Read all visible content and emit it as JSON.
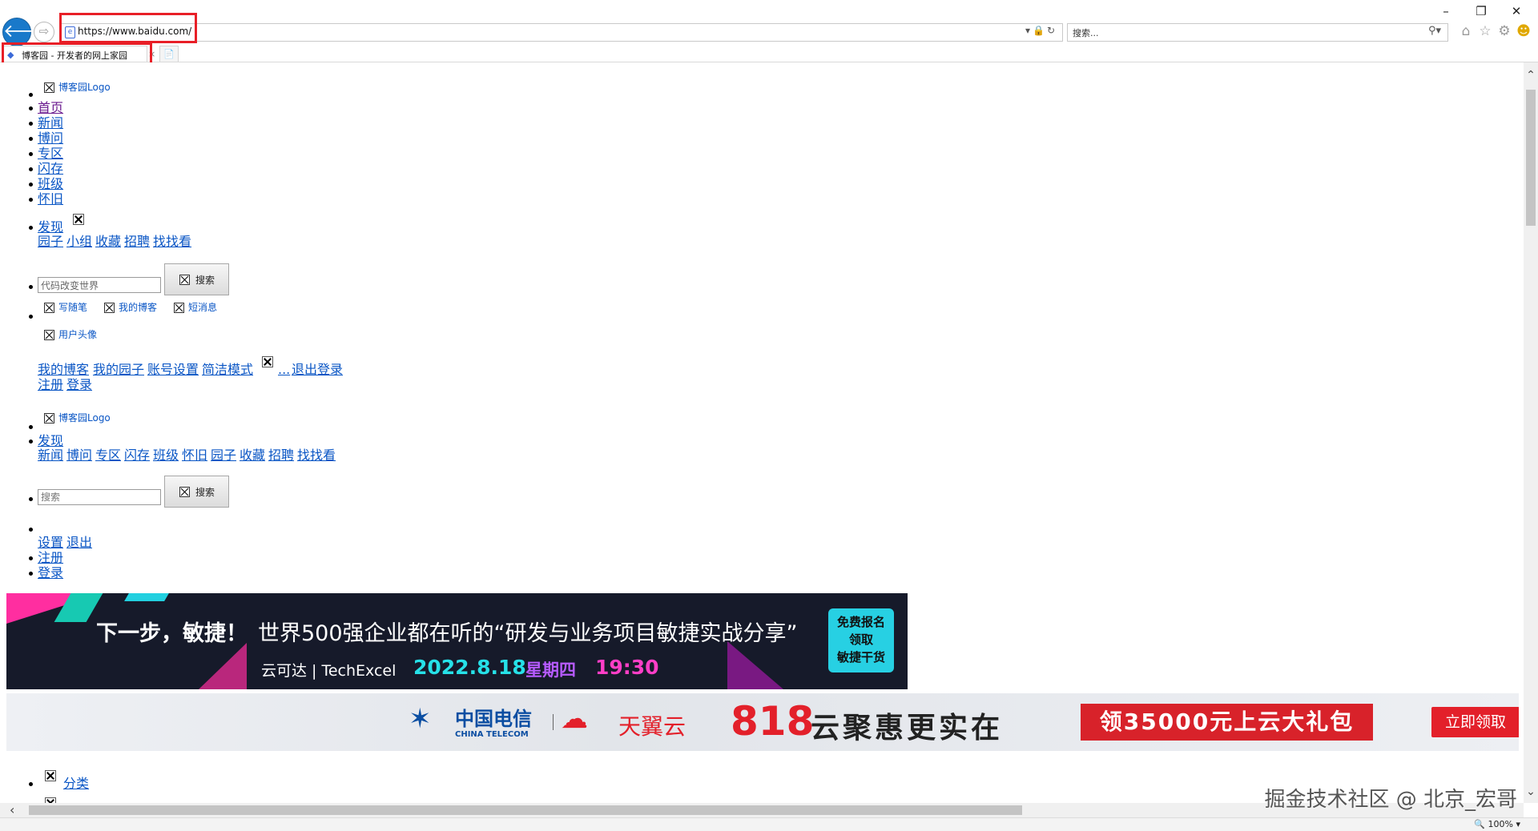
{
  "browser": {
    "url": "https://www.baidu.com/",
    "search_placeholder": "搜索...",
    "tab_title": "博客园 - 开发者的网上家园",
    "zoom": "100%"
  },
  "nav": {
    "logo_alt": "博客园Logo",
    "items": [
      "首页",
      "新闻",
      "博问",
      "专区",
      "闪存",
      "班级",
      "怀旧"
    ],
    "discover": "发现",
    "discover_sub": [
      "园子",
      "小组",
      "收藏",
      "招聘",
      "找找看"
    ],
    "search_value": "代码改变世界",
    "search_button": "搜索",
    "write_post": "写随笔",
    "my_blog": "我的博客",
    "short_msg": "短消息",
    "user_avatar": "用户头像",
    "user_menu": [
      "我的博客",
      "我的园子",
      "账号设置",
      "简洁模式"
    ],
    "logout_dots": "...",
    "logout": "退出登录",
    "register": "注册",
    "login": "登录"
  },
  "nav2": {
    "logo_alt": "博客园Logo",
    "discover": "发现",
    "sub": [
      "新闻",
      "博问",
      "专区",
      "闪存",
      "班级",
      "怀旧",
      "园子",
      "收藏",
      "招聘",
      "找找看"
    ],
    "search_placeholder": "搜索",
    "search_button": "搜索",
    "settings": "设置",
    "logout": "退出",
    "register": "注册",
    "login": "登录"
  },
  "banner1": {
    "title": "下一步，敏捷！",
    "subtitle": "世界500强企业都在听的“研发与业务项目敏捷实战分享”",
    "logos": "云可达 | TechExcel",
    "date": "2022.8.18",
    "weekday": "星期四",
    "time": "19:30",
    "cta": [
      "免费报名",
      "领取",
      "敏捷干货"
    ]
  },
  "banner2": {
    "ct_cn": "中国电信",
    "ct_en": "CHINA TELECOM",
    "tyy": "天翼云",
    "num": "818",
    "slogan": "云聚惠更实在",
    "gift": "领35000元上云大礼包",
    "button": "立即领取"
  },
  "category": "分类",
  "watermark": "掘金技术社区 @ 北京_宏哥",
  "colors": {
    "link": "#0a56c5",
    "visited": "#6a1a8f",
    "highlight": "#e81f27",
    "ie_blue": "#1979ca"
  }
}
